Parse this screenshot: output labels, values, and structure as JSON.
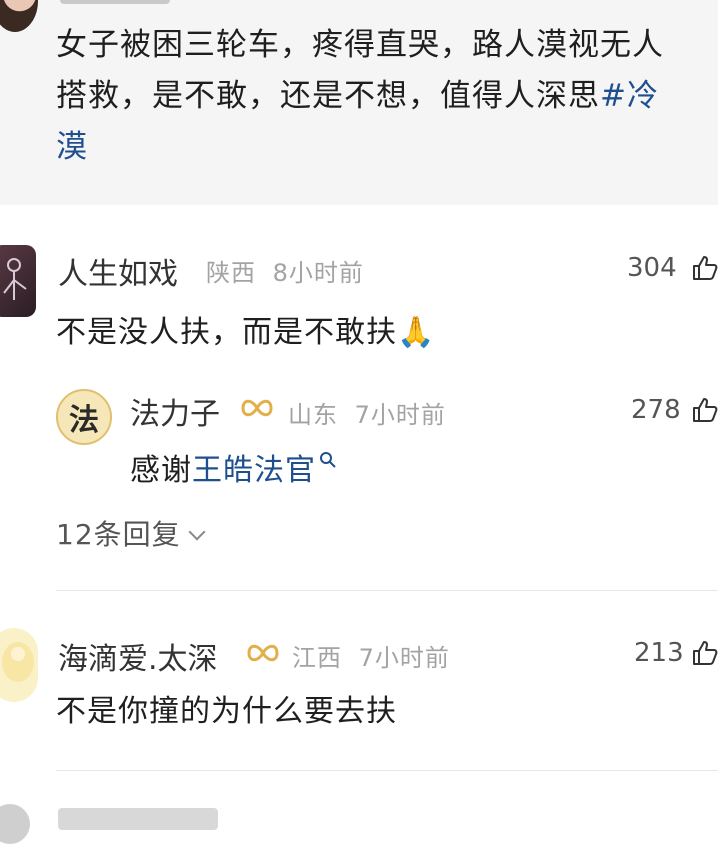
{
  "post": {
    "text_before_tag": "女子被困三轮车，疼得直哭，路人漠视无人\n搭救，是不敢，还是不想，值得人深思",
    "topic_tag": "#冷\n漠"
  },
  "comments": [
    {
      "author": "人生如戏",
      "location": "陕西",
      "time": "8小时前",
      "likes": "304",
      "text": "不是没人扶，而是不敢扶🙏"
    },
    {
      "author": "法力子",
      "avatar_char": "法",
      "location": "山东",
      "time": "7小时前",
      "likes": "278",
      "text_prefix": "感谢",
      "text_link": "王皓法官",
      "reply": true
    },
    {
      "author": "海滴爱.太深",
      "location": "江西",
      "time": "7小时前",
      "likes": "213",
      "text": "不是你撞的为什么要去扶"
    }
  ],
  "replies_label": "12条回复",
  "colors": {
    "link": "#1f4f8f",
    "meta": "#a3a3a3",
    "badge": "#e2b04a",
    "post_bg": "#f5f5f5"
  },
  "icons": {
    "like": "thumbs-up-outline",
    "search": "search-magnifier",
    "badge": "gold-infinity-badge",
    "chevron": "chevron-down"
  }
}
